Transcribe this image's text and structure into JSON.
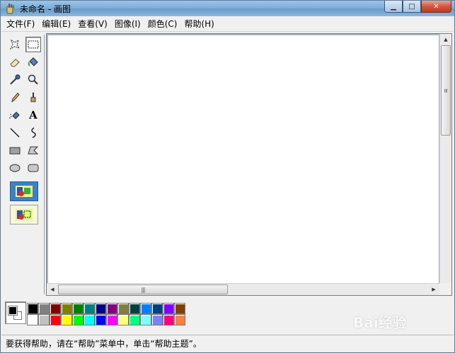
{
  "window": {
    "title": "未命名 - 画图",
    "minimize_label": "▁",
    "maximize_label": "□",
    "close_label": "✕"
  },
  "menu": [
    {
      "label": "文件(F)"
    },
    {
      "label": "编辑(E)"
    },
    {
      "label": "查看(V)"
    },
    {
      "label": "图像(I)"
    },
    {
      "label": "颜色(C)"
    },
    {
      "label": "帮助(H)"
    }
  ],
  "toolbox": {
    "tools": [
      {
        "name": "free-select-icon"
      },
      {
        "name": "rect-select-icon",
        "selected": true
      },
      {
        "name": "eraser-icon"
      },
      {
        "name": "fill-bucket-icon"
      },
      {
        "name": "color-picker-icon"
      },
      {
        "name": "magnifier-icon"
      },
      {
        "name": "pencil-icon"
      },
      {
        "name": "brush-icon"
      },
      {
        "name": "airbrush-icon"
      },
      {
        "name": "text-icon",
        "glyph": "A"
      },
      {
        "name": "line-icon"
      },
      {
        "name": "curve-icon"
      },
      {
        "name": "rectangle-icon"
      },
      {
        "name": "polygon-icon"
      },
      {
        "name": "ellipse-icon"
      },
      {
        "name": "rounded-rect-icon"
      }
    ],
    "options": [
      {
        "name": "opaque-background-option-icon",
        "selected": true
      },
      {
        "name": "transparent-background-option-icon",
        "selected": false
      }
    ]
  },
  "palette": {
    "foreground": "#000000",
    "background": "#ffffff",
    "colors": [
      "#000000",
      "#808080",
      "#800000",
      "#808000",
      "#008000",
      "#008080",
      "#000080",
      "#800080",
      "#808040",
      "#004040",
      "#0080ff",
      "#004080",
      "#8000ff",
      "#804000",
      "#ffffff",
      "#c0c0c0",
      "#ff0000",
      "#ffff00",
      "#00ff00",
      "#00ffff",
      "#0000ff",
      "#ff00ff",
      "#ffff80",
      "#00ff80",
      "#80ffff",
      "#8080ff",
      "#ff0080",
      "#ff8040"
    ]
  },
  "status": {
    "text": "要获得帮助，请在“帮助”菜单中，单击“帮助主题”。"
  },
  "watermark": {
    "text": "Bai经验"
  },
  "scroll": {
    "grip": "|||"
  }
}
